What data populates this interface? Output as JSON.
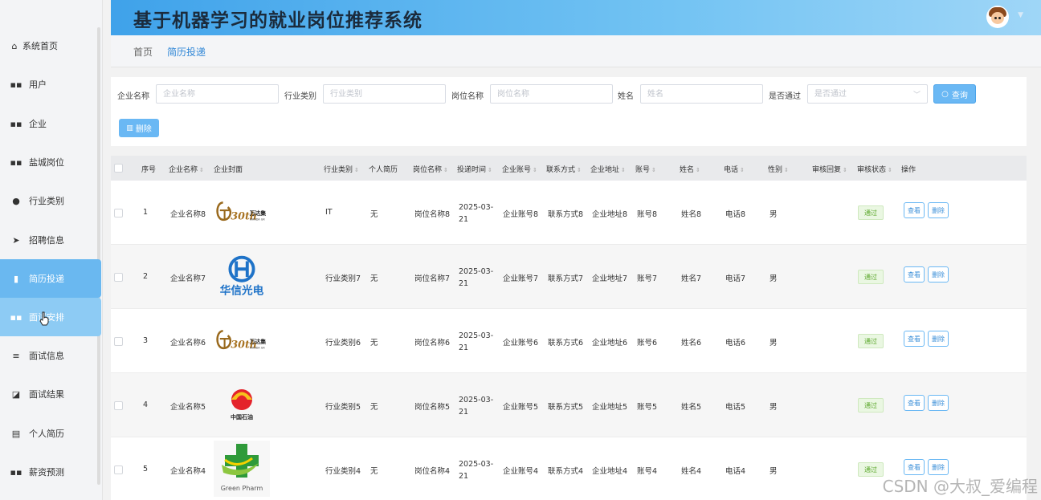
{
  "app": {
    "title": "基于机器学习的就业岗位推荐系统"
  },
  "sidebar": {
    "items": [
      {
        "label": "系统首页",
        "icon": "home-icon"
      },
      {
        "label": "用户",
        "icon": "grid-icon"
      },
      {
        "label": "企业",
        "icon": "grid-icon"
      },
      {
        "label": "盐城岗位",
        "icon": "grid-icon"
      },
      {
        "label": "行业类别",
        "icon": "location-pin-icon"
      },
      {
        "label": "招聘信息",
        "icon": "send-icon"
      },
      {
        "label": "简历投递",
        "icon": "bar-chart-icon"
      },
      {
        "label": "面试安排",
        "icon": "grid-icon"
      },
      {
        "label": "面试信息",
        "icon": "sliders-icon"
      },
      {
        "label": "面试结果",
        "icon": "line-chart-icon"
      },
      {
        "label": "个人简历",
        "icon": "clipboard-icon"
      },
      {
        "label": "薪资预测",
        "icon": "grid-icon"
      }
    ]
  },
  "breadcrumb": {
    "home": "首页",
    "current": "简历投递"
  },
  "filter": {
    "company_label": "企业名称",
    "company_placeholder": "企业名称",
    "industry_label": "行业类别",
    "industry_placeholder": "行业类别",
    "position_label": "岗位名称",
    "position_placeholder": "岗位名称",
    "name_label": "姓名",
    "name_placeholder": "姓名",
    "passed_label": "是否通过",
    "passed_placeholder": "是否通过",
    "query_button": "查询",
    "delete_button": "删除"
  },
  "table": {
    "headers": {
      "index": "序号",
      "company": "企业名称",
      "cover": "企业封面",
      "industry": "行业类别",
      "resume": "个人简历",
      "position": "岗位名称",
      "time": "投递时间",
      "account": "企业账号",
      "contact": "联系方式",
      "address": "企业地址",
      "user": "账号",
      "name": "姓名",
      "phone": "电话",
      "gender": "性别",
      "reply": "审核回复",
      "status": "审核状态",
      "ops": "操作"
    },
    "rows": [
      {
        "index": "1",
        "company": "企业名称8",
        "logo": "wanda",
        "industry": "IT",
        "resume": "无",
        "position": "岗位名称8",
        "time": "2025-03-21",
        "account": "企业账号8",
        "contact": "联系方式8",
        "address": "企业地址8",
        "user": "账号8",
        "name": "姓名8",
        "phone": "电话8",
        "gender": "男",
        "status": "通过",
        "view": "查看",
        "del": "删除"
      },
      {
        "index": "2",
        "company": "企业名称7",
        "logo": "huaxin",
        "industry": "行业类别7",
        "resume": "无",
        "position": "岗位名称7",
        "time": "2025-03-21",
        "account": "企业账号7",
        "contact": "联系方式7",
        "address": "企业地址7",
        "user": "账号7",
        "name": "姓名7",
        "phone": "电话7",
        "gender": "男",
        "status": "通过",
        "view": "查看",
        "del": "删除"
      },
      {
        "index": "3",
        "company": "企业名称6",
        "logo": "wanda",
        "industry": "行业类别6",
        "resume": "无",
        "position": "岗位名称6",
        "time": "2025-03-21",
        "account": "企业账号6",
        "contact": "联系方式6",
        "address": "企业地址6",
        "user": "账号6",
        "name": "姓名6",
        "phone": "电话6",
        "gender": "男",
        "status": "通过",
        "view": "查看",
        "del": "删除"
      },
      {
        "index": "4",
        "company": "企业名称5",
        "logo": "petrochina",
        "industry": "行业类别5",
        "resume": "无",
        "position": "岗位名称5",
        "time": "2025-03-21",
        "account": "企业账号5",
        "contact": "联系方式5",
        "address": "企业地址5",
        "user": "账号5",
        "name": "姓名5",
        "phone": "电话5",
        "gender": "男",
        "status": "通过",
        "view": "查看",
        "del": "删除"
      },
      {
        "index": "5",
        "company": "企业名称4",
        "logo": "greenpharm",
        "industry": "行业类别4",
        "resume": "无",
        "position": "岗位名称4",
        "time": "2025-03-21",
        "account": "企业账号4",
        "contact": "联系方式4",
        "address": "企业地址4",
        "user": "账号4",
        "name": "姓名4",
        "phone": "电话4",
        "gender": "男",
        "status": "通过",
        "view": "查看",
        "del": "删除"
      }
    ]
  },
  "logos": {
    "wanda_text": "万达集",
    "wanda_sub": "WANDA GR",
    "wanda_num": "30th",
    "huaxin_text": "华信光电",
    "petrochina_text": "中国石油",
    "greenpharm_text": "Green Pharm"
  },
  "watermark": "CSDN @大叔_爱编程"
}
